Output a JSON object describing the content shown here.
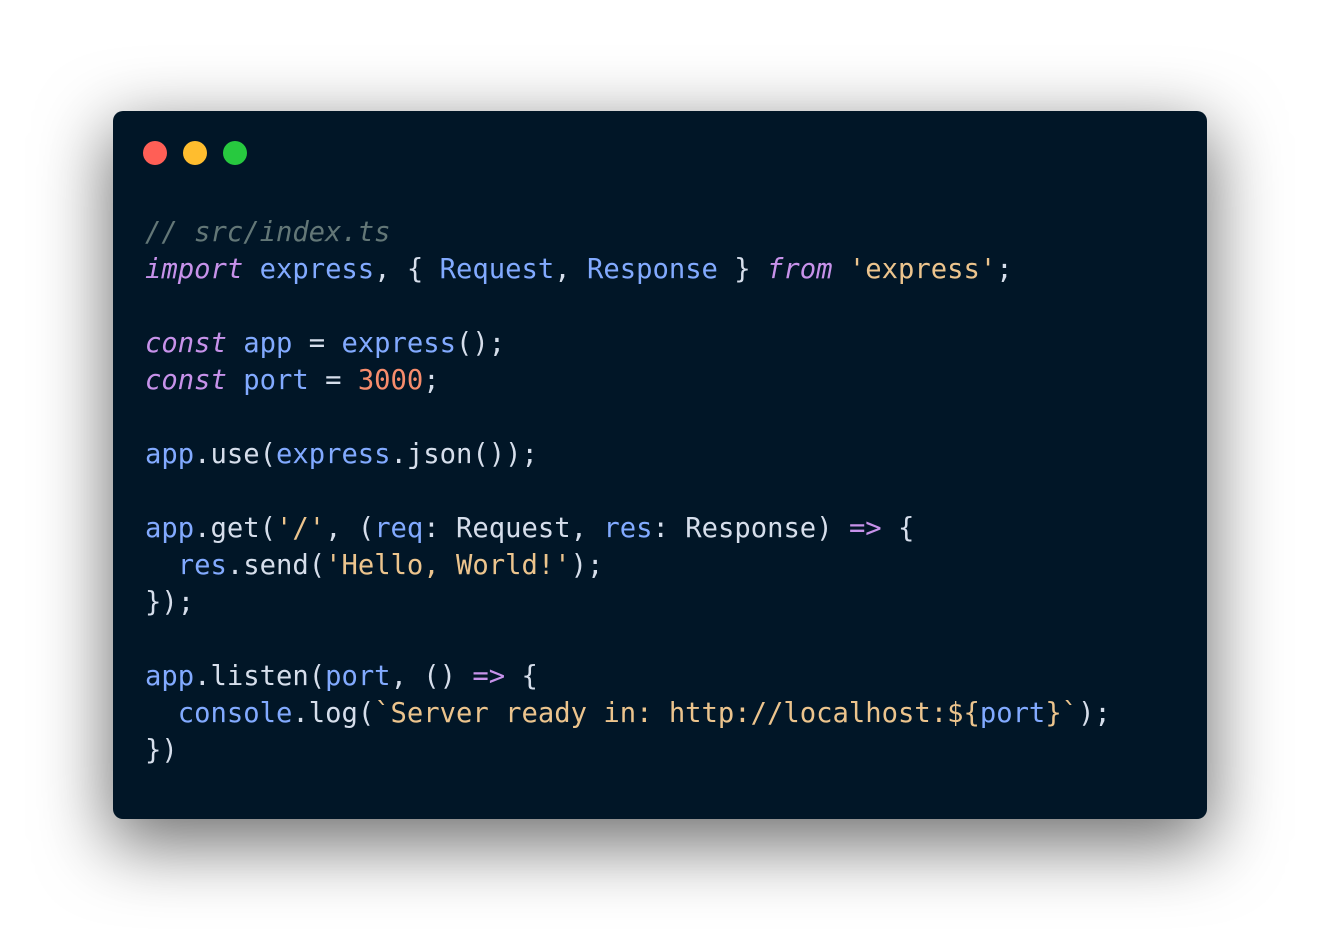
{
  "window": {
    "controls": [
      {
        "name": "close",
        "color": "#ff5f56"
      },
      {
        "name": "minimize",
        "color": "#ffbd2e"
      },
      {
        "name": "maximize",
        "color": "#27c93f"
      }
    ]
  },
  "theme": {
    "background": "#011627",
    "default": "#d6deeb",
    "comment": "#637777",
    "keyword": "#c792ea",
    "variable": "#82aaff",
    "string": "#ecc48d",
    "number": "#f78c6c",
    "punctuation": "#d6deeb",
    "type": "#d6deeb"
  },
  "code": {
    "lines": [
      {
        "tokens": [
          {
            "t": "// src/index.ts",
            "k": "comment"
          }
        ]
      },
      {
        "tokens": [
          {
            "t": "import",
            "k": "keyword"
          },
          {
            "t": " ",
            "k": "default"
          },
          {
            "t": "express",
            "k": "variable"
          },
          {
            "t": ", { ",
            "k": "punctuation"
          },
          {
            "t": "Request",
            "k": "variable"
          },
          {
            "t": ", ",
            "k": "punctuation"
          },
          {
            "t": "Response",
            "k": "variable"
          },
          {
            "t": " } ",
            "k": "punctuation"
          },
          {
            "t": "from",
            "k": "keyword"
          },
          {
            "t": " ",
            "k": "default"
          },
          {
            "t": "'express'",
            "k": "string"
          },
          {
            "t": ";",
            "k": "punctuation"
          }
        ]
      },
      {
        "blank": true
      },
      {
        "tokens": [
          {
            "t": "const",
            "k": "keyword"
          },
          {
            "t": " ",
            "k": "default"
          },
          {
            "t": "app",
            "k": "variable"
          },
          {
            "t": " = ",
            "k": "punctuation"
          },
          {
            "t": "express",
            "k": "variable"
          },
          {
            "t": "();",
            "k": "punctuation"
          }
        ]
      },
      {
        "tokens": [
          {
            "t": "const",
            "k": "keyword"
          },
          {
            "t": " ",
            "k": "default"
          },
          {
            "t": "port",
            "k": "variable"
          },
          {
            "t": " = ",
            "k": "punctuation"
          },
          {
            "t": "3000",
            "k": "number"
          },
          {
            "t": ";",
            "k": "punctuation"
          }
        ]
      },
      {
        "blank": true
      },
      {
        "tokens": [
          {
            "t": "app",
            "k": "variable"
          },
          {
            "t": ".",
            "k": "punctuation"
          },
          {
            "t": "use",
            "k": "default"
          },
          {
            "t": "(",
            "k": "punctuation"
          },
          {
            "t": "express",
            "k": "variable"
          },
          {
            "t": ".",
            "k": "punctuation"
          },
          {
            "t": "json",
            "k": "default"
          },
          {
            "t": "());",
            "k": "punctuation"
          }
        ]
      },
      {
        "blank": true
      },
      {
        "tokens": [
          {
            "t": "app",
            "k": "variable"
          },
          {
            "t": ".",
            "k": "punctuation"
          },
          {
            "t": "get",
            "k": "default"
          },
          {
            "t": "(",
            "k": "punctuation"
          },
          {
            "t": "'/'",
            "k": "string"
          },
          {
            "t": ", (",
            "k": "punctuation"
          },
          {
            "t": "req",
            "k": "variable"
          },
          {
            "t": ": ",
            "k": "punctuation"
          },
          {
            "t": "Request",
            "k": "type"
          },
          {
            "t": ", ",
            "k": "punctuation"
          },
          {
            "t": "res",
            "k": "variable"
          },
          {
            "t": ": ",
            "k": "punctuation"
          },
          {
            "t": "Response",
            "k": "type"
          },
          {
            "t": ") ",
            "k": "punctuation"
          },
          {
            "t": "=>",
            "k": "keyword"
          },
          {
            "t": " {",
            "k": "punctuation"
          }
        ]
      },
      {
        "tokens": [
          {
            "t": "  ",
            "k": "default"
          },
          {
            "t": "res",
            "k": "variable"
          },
          {
            "t": ".",
            "k": "punctuation"
          },
          {
            "t": "send",
            "k": "default"
          },
          {
            "t": "(",
            "k": "punctuation"
          },
          {
            "t": "'Hello, World!'",
            "k": "string"
          },
          {
            "t": ");",
            "k": "punctuation"
          }
        ]
      },
      {
        "tokens": [
          {
            "t": "});",
            "k": "punctuation"
          }
        ]
      },
      {
        "blank": true
      },
      {
        "tokens": [
          {
            "t": "app",
            "k": "variable"
          },
          {
            "t": ".",
            "k": "punctuation"
          },
          {
            "t": "listen",
            "k": "default"
          },
          {
            "t": "(",
            "k": "punctuation"
          },
          {
            "t": "port",
            "k": "variable"
          },
          {
            "t": ", () ",
            "k": "punctuation"
          },
          {
            "t": "=>",
            "k": "keyword"
          },
          {
            "t": " {",
            "k": "punctuation"
          }
        ]
      },
      {
        "tokens": [
          {
            "t": "  ",
            "k": "default"
          },
          {
            "t": "console",
            "k": "variable"
          },
          {
            "t": ".",
            "k": "punctuation"
          },
          {
            "t": "log",
            "k": "default"
          },
          {
            "t": "(",
            "k": "punctuation"
          },
          {
            "t": "`Server ready in: http://localhost:${",
            "k": "string"
          },
          {
            "t": "port",
            "k": "variable"
          },
          {
            "t": "}`",
            "k": "string"
          },
          {
            "t": ");",
            "k": "punctuation"
          }
        ]
      },
      {
        "tokens": [
          {
            "t": "})",
            "k": "punctuation"
          }
        ]
      }
    ]
  }
}
